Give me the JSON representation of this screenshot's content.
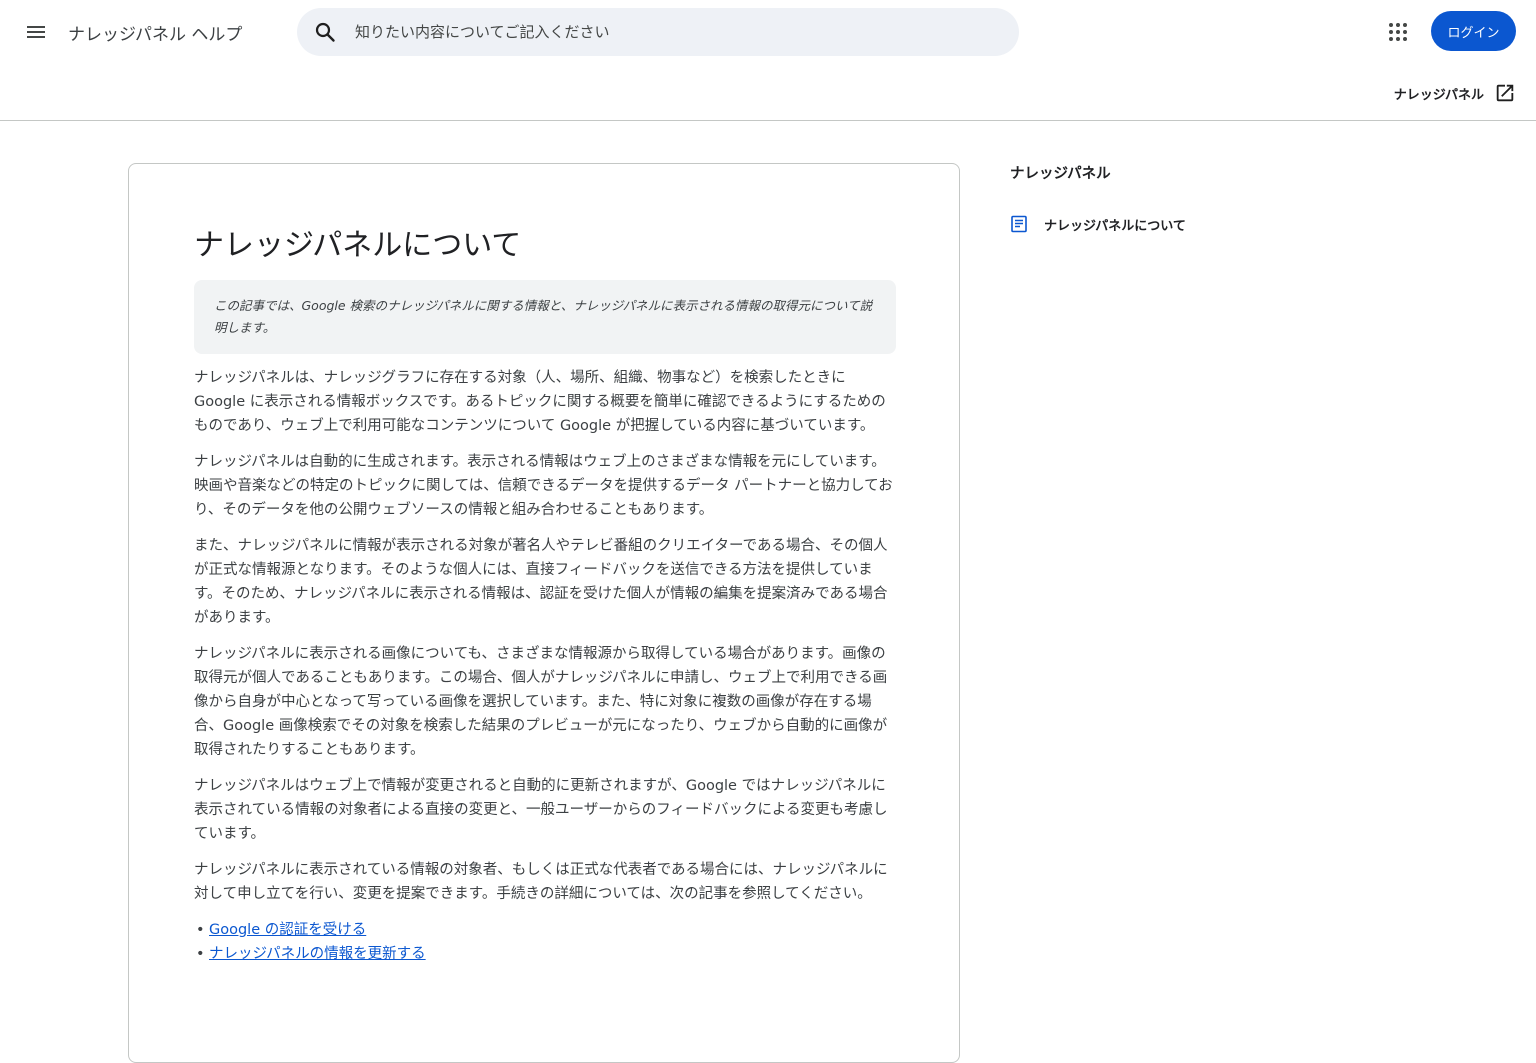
{
  "header": {
    "product_name": "ナレッジパネル ヘルプ",
    "search_placeholder": "知りたい内容についてご記入ください",
    "login_label": "ログイン",
    "icons": {
      "menu": "menu-icon",
      "search": "search-icon",
      "apps": "apps-grid-icon"
    },
    "accent_color": "#0b57d0"
  },
  "subheader": {
    "external_link_label": "ナレッジパネル",
    "icon": "open-in-new-icon"
  },
  "article": {
    "title": "ナレッジパネルについて",
    "summary": "この記事では、Google 検索のナレッジパネルに関する情報と、ナレッジパネルに表示される情報の取得元について説明します。",
    "paragraphs": [
      "ナレッジパネルは、ナレッジグラフに存在する対象（人、場所、組織、物事など）を検索したときに Google に表示される情報ボックスです。あるトピックに関する概要を簡単に確認できるようにするためのものであり、ウェブ上で利用可能なコンテンツについて Google が把握している内容に基づいています。",
      "ナレッジパネルは自動的に生成されます。表示される情報はウェブ上のさまざまな情報を元にしています。映画や音楽などの特定のトピックに関しては、信頼できるデータを提供するデータ パートナーと協力しており、そのデータを他の公開ウェブソースの情報と組み合わせることもあります。",
      "また、ナレッジパネルに情報が表示される対象が著名人やテレビ番組のクリエイターである場合、その個人が正式な情報源となります。そのような個人には、直接フィードバックを送信できる方法を提供しています。そのため、ナレッジパネルに表示される情報は、認証を受けた個人が情報の編集を提案済みである場合があります。",
      "ナレッジパネルに表示される画像についても、さまざまな情報源から取得している場合があります。画像の取得元が個人であることもあります。この場合、個人がナレッジパネルに申請し、ウェブ上で利用できる画像から自身が中心となって写っている画像を選択しています。また、特に対象に複数の画像が存在する場合、Google 画像検索でその対象を検索した結果のプレビューが元になったり、ウェブから自動的に画像が取得されたりすることもあります。",
      "ナレッジパネルはウェブ上で情報が変更されると自動的に更新されますが、Google ではナレッジパネルに表示されている情報の対象者による直接の変更と、一般ユーザーからのフィードバックによる変更も考慮しています。",
      "ナレッジパネルに表示されている情報の対象者、もしくは正式な代表者である場合には、ナレッジパネルに対して申し立てを行い、変更を提案できます。手続きの詳細については、次の記事を参照してください。"
    ],
    "links": [
      "Google の認証を受ける",
      "ナレッジパネルの情報を更新する"
    ]
  },
  "side_nav": {
    "title": "ナレッジパネル",
    "items": [
      {
        "label": "ナレッジパネルについて",
        "icon": "article-icon"
      }
    ]
  }
}
